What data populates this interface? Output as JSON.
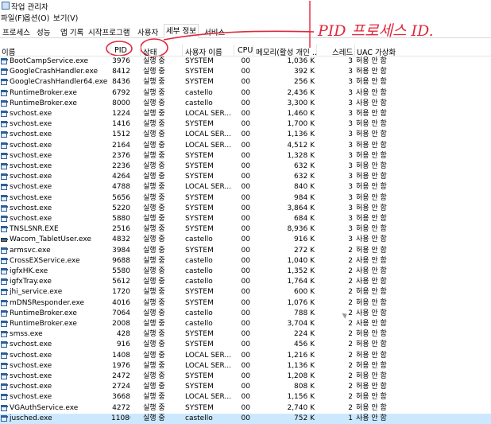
{
  "window": {
    "title": "작업 관리자"
  },
  "menu": [
    "파일(F)",
    "옵션(O)",
    "보기(V)"
  ],
  "tabs": [
    "프로세스",
    "성능",
    "앱 기록",
    "시작프로그램",
    "사용자",
    "세부 정보",
    "서비스"
  ],
  "active_tab": "세부 정보",
  "columns": {
    "name": "이름",
    "pid": "PID",
    "status": "상태",
    "user": "사용자 이름",
    "cpu": "CPU",
    "memory": "메모리(활성 개인 ...",
    "threads": "스레드",
    "uac": "UAC 가상화"
  },
  "annotation": {
    "text": "PID 프로세스 ID.",
    "color": "#e0283c"
  },
  "processes": [
    {
      "name": "BootCampService.exe",
      "pid": "3976",
      "status": "실행 중",
      "user": "SYSTEM",
      "cpu": "00",
      "memory": "1,036 K",
      "threads": "3",
      "uac": "허용 안 함",
      "icon": "blue"
    },
    {
      "name": "GoogleCrashHandler.exe",
      "pid": "8412",
      "status": "실행 중",
      "user": "SYSTEM",
      "cpu": "00",
      "memory": "392 K",
      "threads": "3",
      "uac": "허용 안 함",
      "icon": "blue"
    },
    {
      "name": "GoogleCrashHandler64.exe",
      "pid": "8436",
      "status": "실행 중",
      "user": "SYSTEM",
      "cpu": "00",
      "memory": "256 K",
      "threads": "3",
      "uac": "허용 안 함",
      "icon": "blue"
    },
    {
      "name": "RuntimeBroker.exe",
      "pid": "6792",
      "status": "실행 중",
      "user": "castello",
      "cpu": "00",
      "memory": "2,436 K",
      "threads": "3",
      "uac": "사용 안 함",
      "icon": "blue"
    },
    {
      "name": "RuntimeBroker.exe",
      "pid": "8000",
      "status": "실행 중",
      "user": "castello",
      "cpu": "00",
      "memory": "3,300 K",
      "threads": "3",
      "uac": "사용 안 함",
      "icon": "blue"
    },
    {
      "name": "svchost.exe",
      "pid": "1224",
      "status": "실행 중",
      "user": "LOCAL SER...",
      "cpu": "00",
      "memory": "1,460 K",
      "threads": "3",
      "uac": "허용 안 함",
      "icon": "blue"
    },
    {
      "name": "svchost.exe",
      "pid": "1416",
      "status": "실행 중",
      "user": "SYSTEM",
      "cpu": "00",
      "memory": "1,700 K",
      "threads": "3",
      "uac": "허용 안 함",
      "icon": "blue"
    },
    {
      "name": "svchost.exe",
      "pid": "1512",
      "status": "실행 중",
      "user": "LOCAL SER...",
      "cpu": "00",
      "memory": "1,136 K",
      "threads": "3",
      "uac": "허용 안 함",
      "icon": "blue"
    },
    {
      "name": "svchost.exe",
      "pid": "2164",
      "status": "실행 중",
      "user": "LOCAL SER...",
      "cpu": "00",
      "memory": "4,512 K",
      "threads": "3",
      "uac": "허용 안 함",
      "icon": "blue"
    },
    {
      "name": "svchost.exe",
      "pid": "2376",
      "status": "실행 중",
      "user": "SYSTEM",
      "cpu": "00",
      "memory": "1,328 K",
      "threads": "3",
      "uac": "허용 안 함",
      "icon": "blue"
    },
    {
      "name": "svchost.exe",
      "pid": "2236",
      "status": "실행 중",
      "user": "SYSTEM",
      "cpu": "00",
      "memory": "632 K",
      "threads": "3",
      "uac": "허용 안 함",
      "icon": "blue"
    },
    {
      "name": "svchost.exe",
      "pid": "4264",
      "status": "실행 중",
      "user": "SYSTEM",
      "cpu": "00",
      "memory": "632 K",
      "threads": "3",
      "uac": "허용 안 함",
      "icon": "blue"
    },
    {
      "name": "svchost.exe",
      "pid": "4788",
      "status": "실행 중",
      "user": "LOCAL SER...",
      "cpu": "00",
      "memory": "840 K",
      "threads": "3",
      "uac": "허용 안 함",
      "icon": "blue"
    },
    {
      "name": "svchost.exe",
      "pid": "5656",
      "status": "실행 중",
      "user": "SYSTEM",
      "cpu": "00",
      "memory": "984 K",
      "threads": "3",
      "uac": "허용 안 함",
      "icon": "blue"
    },
    {
      "name": "svchost.exe",
      "pid": "5220",
      "status": "실행 중",
      "user": "SYSTEM",
      "cpu": "00",
      "memory": "3,864 K",
      "threads": "3",
      "uac": "허용 안 함",
      "icon": "blue"
    },
    {
      "name": "svchost.exe",
      "pid": "5880",
      "status": "실행 중",
      "user": "SYSTEM",
      "cpu": "00",
      "memory": "684 K",
      "threads": "3",
      "uac": "허용 안 함",
      "icon": "blue"
    },
    {
      "name": "TNSLSNR.EXE",
      "pid": "2516",
      "status": "실행 중",
      "user": "SYSTEM",
      "cpu": "00",
      "memory": "8,936 K",
      "threads": "3",
      "uac": "허용 안 함",
      "icon": "blue"
    },
    {
      "name": "Wacom_TabletUser.exe",
      "pid": "4832",
      "status": "실행 중",
      "user": "castello",
      "cpu": "00",
      "memory": "916 K",
      "threads": "3",
      "uac": "사용 안 함",
      "icon": "pen"
    },
    {
      "name": "armsvc.exe",
      "pid": "3984",
      "status": "실행 중",
      "user": "SYSTEM",
      "cpu": "00",
      "memory": "272 K",
      "threads": "2",
      "uac": "허용 안 함",
      "icon": "blue"
    },
    {
      "name": "CrossEXService.exe",
      "pid": "9688",
      "status": "실행 중",
      "user": "castello",
      "cpu": "00",
      "memory": "1,040 K",
      "threads": "2",
      "uac": "사용 안 함",
      "icon": "blue"
    },
    {
      "name": "igfxHK.exe",
      "pid": "5580",
      "status": "실행 중",
      "user": "castello",
      "cpu": "00",
      "memory": "1,352 K",
      "threads": "2",
      "uac": "사용 안 함",
      "icon": "blue"
    },
    {
      "name": "igfxTray.exe",
      "pid": "5612",
      "status": "실행 중",
      "user": "castello",
      "cpu": "00",
      "memory": "1,764 K",
      "threads": "2",
      "uac": "사용 안 함",
      "icon": "blue"
    },
    {
      "name": "jhi_service.exe",
      "pid": "1720",
      "status": "실행 중",
      "user": "SYSTEM",
      "cpu": "00",
      "memory": "600 K",
      "threads": "2",
      "uac": "허용 안 함",
      "icon": "blue"
    },
    {
      "name": "mDNSResponder.exe",
      "pid": "4016",
      "status": "실행 중",
      "user": "SYSTEM",
      "cpu": "00",
      "memory": "1,076 K",
      "threads": "2",
      "uac": "허용 안 함",
      "icon": "blue"
    },
    {
      "name": "RuntimeBroker.exe",
      "pid": "7064",
      "status": "실행 중",
      "user": "castello",
      "cpu": "00",
      "memory": "788 K",
      "threads": "2",
      "uac": "사용 안 함",
      "icon": "blue"
    },
    {
      "name": "RuntimeBroker.exe",
      "pid": "2008",
      "status": "실행 중",
      "user": "castello",
      "cpu": "00",
      "memory": "3,704 K",
      "threads": "2",
      "uac": "사용 안 함",
      "icon": "blue"
    },
    {
      "name": "smss.exe",
      "pid": "428",
      "status": "실행 중",
      "user": "SYSTEM",
      "cpu": "00",
      "memory": "224 K",
      "threads": "2",
      "uac": "허용 안 함",
      "icon": "blue"
    },
    {
      "name": "svchost.exe",
      "pid": "916",
      "status": "실행 중",
      "user": "SYSTEM",
      "cpu": "00",
      "memory": "456 K",
      "threads": "2",
      "uac": "허용 안 함",
      "icon": "blue"
    },
    {
      "name": "svchost.exe",
      "pid": "1408",
      "status": "실행 중",
      "user": "LOCAL SER...",
      "cpu": "00",
      "memory": "1,216 K",
      "threads": "2",
      "uac": "허용 안 함",
      "icon": "blue"
    },
    {
      "name": "svchost.exe",
      "pid": "1976",
      "status": "실행 중",
      "user": "LOCAL SER...",
      "cpu": "00",
      "memory": "1,136 K",
      "threads": "2",
      "uac": "허용 안 함",
      "icon": "blue"
    },
    {
      "name": "svchost.exe",
      "pid": "2472",
      "status": "실행 중",
      "user": "SYSTEM",
      "cpu": "00",
      "memory": "1,208 K",
      "threads": "2",
      "uac": "허용 안 함",
      "icon": "blue"
    },
    {
      "name": "svchost.exe",
      "pid": "2724",
      "status": "실행 중",
      "user": "SYSTEM",
      "cpu": "00",
      "memory": "808 K",
      "threads": "2",
      "uac": "허용 안 함",
      "icon": "blue"
    },
    {
      "name": "svchost.exe",
      "pid": "3668",
      "status": "실행 중",
      "user": "LOCAL SER...",
      "cpu": "00",
      "memory": "1,156 K",
      "threads": "2",
      "uac": "허용 안 함",
      "icon": "blue"
    },
    {
      "name": "VGAuthService.exe",
      "pid": "4272",
      "status": "실행 중",
      "user": "SYSTEM",
      "cpu": "00",
      "memory": "2,740 K",
      "threads": "2",
      "uac": "허용 안 함",
      "icon": "blue"
    },
    {
      "name": "jusched.exe",
      "pid": "11080",
      "status": "실행 중",
      "user": "castello",
      "cpu": "00",
      "memory": "752 K",
      "threads": "1",
      "uac": "사용 안 함",
      "icon": "blue",
      "selected": true
    }
  ]
}
